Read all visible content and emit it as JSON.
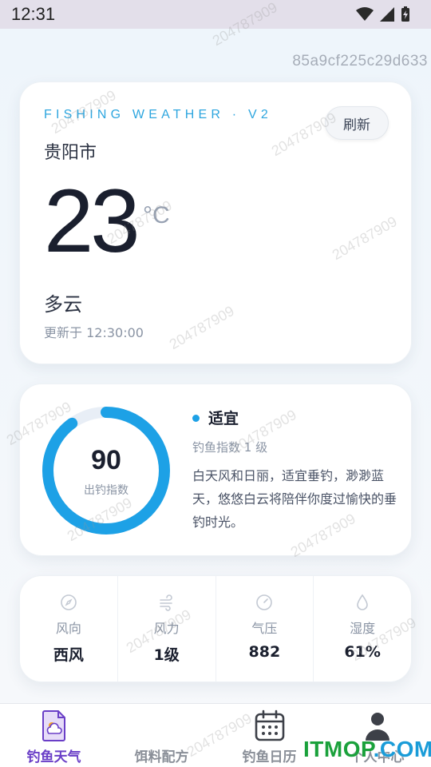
{
  "status_bar": {
    "time": "12:31"
  },
  "hash_label": "85a9cf225c29d633",
  "weather": {
    "brand": "FISHING WEATHER · V2",
    "refresh_label": "刷新",
    "city": "贵阳市",
    "temperature": "23",
    "unit": "°C",
    "condition": "多云",
    "updated": "更新于 12:30:00"
  },
  "fishing_index": {
    "value": "90",
    "value_fraction": 0.9,
    "label": "出钓指数",
    "level_title": "适宜",
    "level_sub": "钓鱼指数 1 级",
    "description": "白天风和日丽，适宜垂钓，渺渺蓝天，悠悠白云将陪伴你度过愉快的垂钓时光。",
    "accent": "#1da1e6"
  },
  "stats": [
    {
      "icon": "compass-icon",
      "label": "风向",
      "value": "西风"
    },
    {
      "icon": "wind-icon",
      "label": "风力",
      "value": "1级"
    },
    {
      "icon": "gauge-icon",
      "label": "气压",
      "value": "882"
    },
    {
      "icon": "droplet-icon",
      "label": "湿度",
      "value": "61%"
    }
  ],
  "tabs": [
    {
      "icon": "weather-doc-icon",
      "label": "钓鱼天气",
      "active": true
    },
    {
      "icon": "bait-icon",
      "label": "饵料配方",
      "active": false
    },
    {
      "icon": "calendar-icon",
      "label": "钓鱼日历",
      "active": false
    },
    {
      "icon": "person-icon",
      "label": "个人中心",
      "active": false
    }
  ],
  "watermark_text": "204787909",
  "overlay_logo": {
    "main": "ITMOP",
    "suffix": ".COM"
  },
  "colors": {
    "accent": "#1da1e6",
    "brand": "#2ea6df",
    "active_tab": "#6a3fc7"
  }
}
